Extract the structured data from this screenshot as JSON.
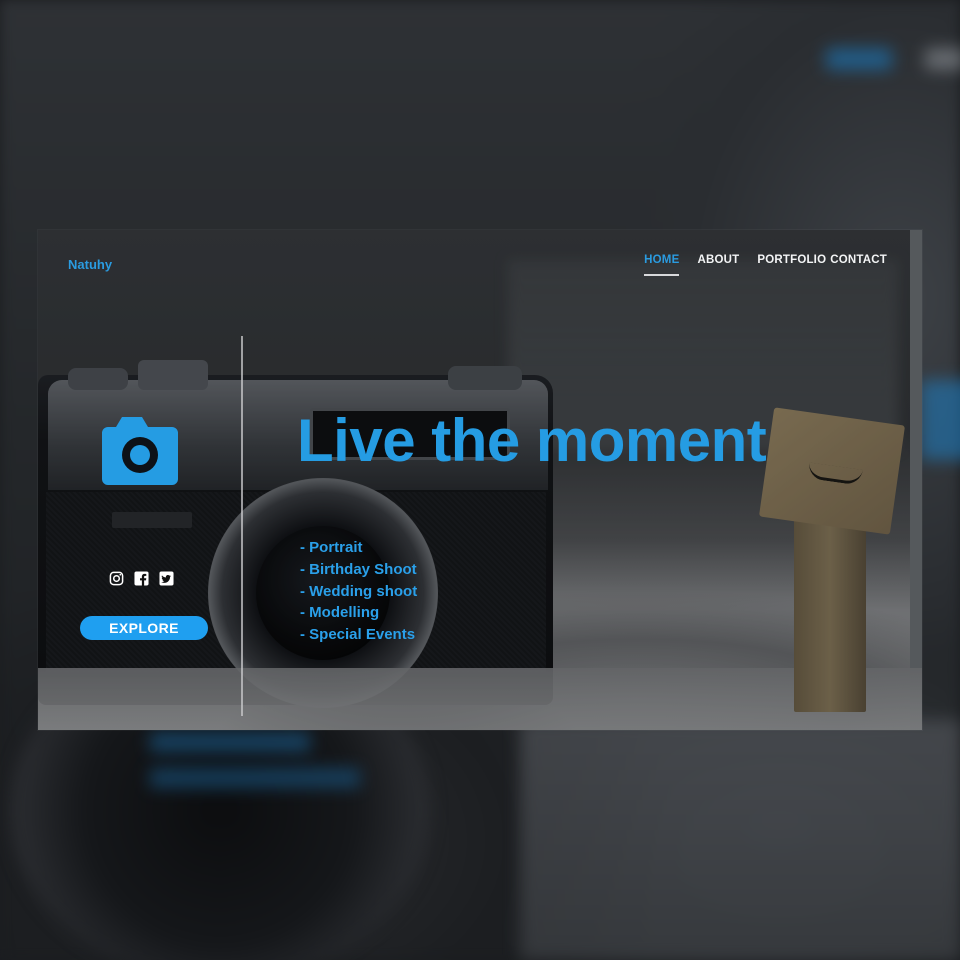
{
  "brand": "Natuhy",
  "nav": {
    "items": [
      {
        "label": "HOME",
        "active": true
      },
      {
        "label": "ABOUT",
        "active": false
      },
      {
        "label": "PORTFOLIO",
        "active": false
      },
      {
        "label": "CONTACT",
        "active": false
      }
    ]
  },
  "hero": {
    "headline": "Live the moment",
    "services": [
      "- Portrait",
      "- Birthday Shoot",
      "- Wedding shoot",
      "- Modelling",
      "- Special Events"
    ],
    "explore_label": "EXPLORE",
    "camera_icon": "camera-icon",
    "social_icons": [
      "instagram-icon",
      "facebook-icon",
      "twitter-icon"
    ]
  },
  "colors": {
    "accent": "#259ce3",
    "button": "#1f9ff0",
    "nav_text": "#f3f4f5"
  }
}
